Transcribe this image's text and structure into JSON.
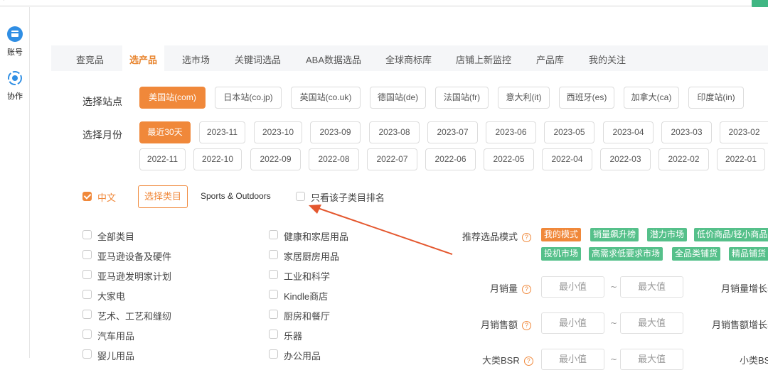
{
  "sidebar": {
    "items": [
      {
        "label": "账号",
        "icon": "account-icon"
      },
      {
        "label": "协作",
        "icon": "collaboration-icon"
      }
    ]
  },
  "tabs": [
    "查竞品",
    "选产品",
    "选市场",
    "关键词选品",
    "ABA数据选品",
    "全球商标库",
    "店铺上新监控",
    "产品库",
    "我的关注"
  ],
  "active_tab": "选产品",
  "site": {
    "label": "选择站点",
    "options": [
      "美国站(com)",
      "日本站(co.jp)",
      "英国站(co.uk)",
      "德国站(de)",
      "法国站(fr)",
      "意大利(it)",
      "西班牙(es)",
      "加拿大(ca)",
      "印度站(in)"
    ],
    "selected": "美国站(com)"
  },
  "month": {
    "label": "选择月份",
    "row1": [
      "最近30天",
      "2023-11",
      "2023-10",
      "2023-09",
      "2023-08",
      "2023-07",
      "2023-06",
      "2023-05",
      "2023-04",
      "2023-03",
      "2023-02"
    ],
    "row2": [
      "2022-11",
      "2022-10",
      "2022-09",
      "2022-08",
      "2022-07",
      "2022-06",
      "2022-05",
      "2022-04",
      "2022-03",
      "2022-02",
      "2022-01"
    ],
    "selected": "最近30天"
  },
  "options_bar": {
    "chinese_label": "中文",
    "chinese_checked": true,
    "select_category_button": "选择类目",
    "selected_category": "Sports & Outdoors",
    "subcategory_only_label": "只看该子类目排名",
    "subcategory_only_checked": false
  },
  "categories": {
    "col1": [
      "全部类目",
      "亚马逊设备及硬件",
      "亚马逊发明家计划",
      "大家电",
      "艺术、工艺和缝纫",
      "汽车用品",
      "婴儿用品"
    ],
    "col2": [
      "健康和家居用品",
      "家居厨房用品",
      "工业和科学",
      "Kindle商店",
      "厨房和餐厅",
      "乐器",
      "办公用品"
    ]
  },
  "recommend": {
    "label": "推荐选品模式",
    "tags_row1": [
      "我的模式",
      "销量飙升榜",
      "潜力市场",
      "低价商品/轻小商品"
    ],
    "tags_row2": [
      "投机市场",
      "高需求低要求市场",
      "全品类铺货",
      "精品铺货"
    ]
  },
  "filters": [
    {
      "label": "月销量",
      "min_placeholder": "最小值",
      "max_placeholder": "最大值",
      "right_label": "月销量增长率"
    },
    {
      "label": "月销售额",
      "min_placeholder": "最小值",
      "max_placeholder": "最大值",
      "right_label": "月销售额增长率"
    },
    {
      "label": "大类BSR",
      "min_placeholder": "最小值",
      "max_placeholder": "最大值",
      "right_label": "小类BSR"
    }
  ],
  "colors": {
    "accent": "#f0883a",
    "green_tag": "#55c08a",
    "arrow": "#e4572e"
  }
}
